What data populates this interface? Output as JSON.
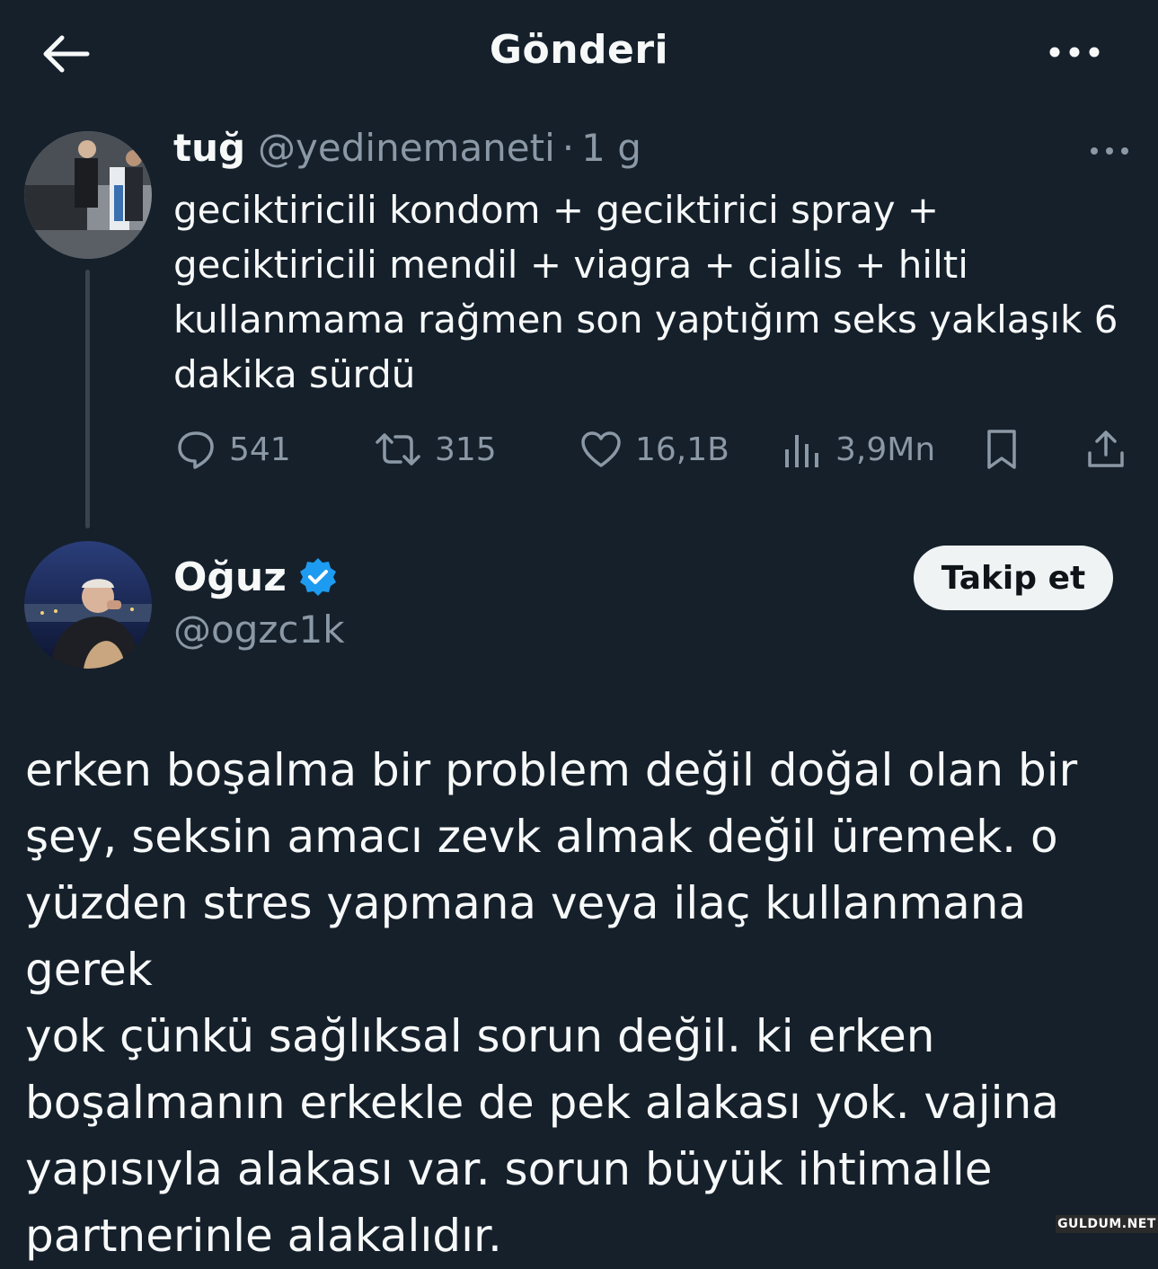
{
  "header": {
    "title": "Gönderi"
  },
  "quoted_tweet": {
    "author_name": "tuğ",
    "handle": "@yedinemaneti",
    "separator": "·",
    "time": "1 g",
    "text": "geciktiricili kondom + geciktirici spray + geciktiricili mendil + viagra + cialis + hilti kullanmama rağmen son yaptığım seks yaklaşık 6 dakika sürdü",
    "actions": {
      "replies": "541",
      "retweets": "315",
      "likes": "16,1B",
      "views": "3,9Mn"
    }
  },
  "main_tweet": {
    "author_name": "Oğuz",
    "handle": "@ogzc1k",
    "follow_label": "Takip et",
    "text": "erken boşalma bir problem değil doğal olan bir\nşey, seksin amacı zevk almak değil üremek. o\nyüzden stres yapmana veya ilaç kullanmana gerek\nyok çünkü sağlıksal sorun değil. ki erken\nboşalmanın erkekle de pek alakası yok. vajina\nyapısıyla alakası var.  sorun büyük ihtimalle\npartnerinle alakalıdır."
  },
  "watermark": "GULDUM.NET",
  "colors": {
    "background": "#15202b",
    "text": "#f7f9f9",
    "muted": "#8b98a5",
    "verified": "#1d9bf0",
    "follow_bg": "#eff3f4"
  }
}
